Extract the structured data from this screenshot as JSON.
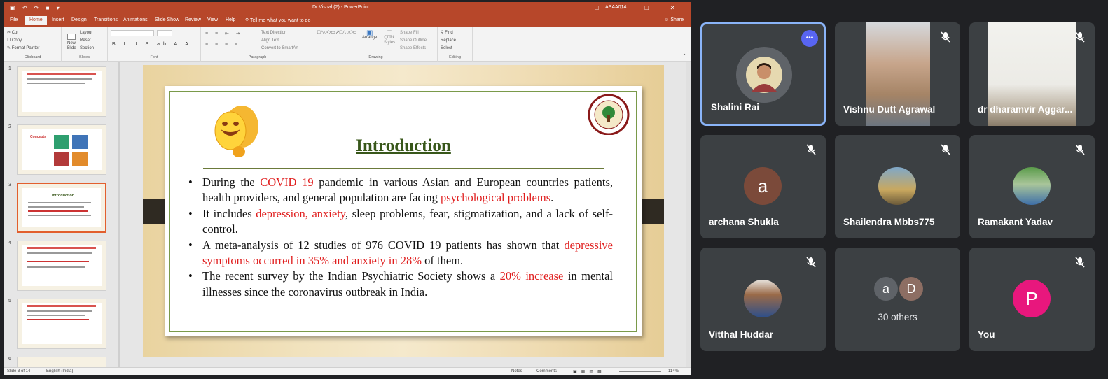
{
  "ppt": {
    "window_title": "Dr Vishal (2) - PowerPoint",
    "user": "ASAA014",
    "share_label": "Share",
    "tabs": [
      "File",
      "Home",
      "Insert",
      "Design",
      "Transitions",
      "Animations",
      "Slide Show",
      "Review",
      "View",
      "Help",
      "Tell me what you want to do"
    ],
    "active_tab": "Home",
    "ribbon": {
      "clipboard": {
        "label": "Clipboard",
        "cut": "Cut",
        "copy": "Copy",
        "format_painter": "Format Painter",
        "paste": "Paste"
      },
      "slides": {
        "label": "Slides",
        "new_slide": "New Slide",
        "layout": "Layout",
        "reset": "Reset",
        "section": "Section"
      },
      "font": {
        "label": "Font"
      },
      "paragraph": {
        "label": "Paragraph",
        "text_direction": "Text Direction",
        "align_text": "Align Text",
        "convert_smartart": "Convert to SmartArt"
      },
      "drawing": {
        "label": "Drawing",
        "arrange": "Arrange",
        "quick_styles": "Quick Styles",
        "shape_fill": "Shape Fill",
        "shape_outline": "Shape Outline",
        "shape_effects": "Shape Effects"
      },
      "editing": {
        "label": "Editing",
        "find": "Find",
        "replace": "Replace",
        "select": "Select"
      }
    },
    "thumbnails": [
      {
        "num": "1"
      },
      {
        "num": "2",
        "title": "Concepts"
      },
      {
        "num": "3",
        "title": "Introduction"
      },
      {
        "num": "4"
      },
      {
        "num": "5"
      },
      {
        "num": "6"
      }
    ],
    "selected_slide": 3,
    "status": {
      "slide": "Slide 3 of 14",
      "language": "English (India)",
      "notes": "Notes",
      "comments": "Comments",
      "zoom": "114%"
    },
    "slide": {
      "heading": "Introduction",
      "bullets": [
        {
          "a": "During the ",
          "b": "COVID 19",
          "c": " pandemic in various Asian and European countries patients, health providers, and general population are facing ",
          "d": "psychological problems",
          "e": "."
        },
        {
          "a": "It includes ",
          "b": "depression, anxiety",
          "c": ", sleep problems, fear, stigmatization, and a lack of self-control."
        },
        {
          "a": "A meta-analysis of 12 studies of 976 COVID 19 patients has shown that ",
          "b": "depressive symptoms occurred in 35% and anxiety in 28%",
          "c": " of them."
        },
        {
          "a": "The recent survey by the Indian Psychiatric Society shows a ",
          "b": "20% increase",
          "c": " in mental illnesses since the coronavirus outbreak in India."
        }
      ]
    }
  },
  "meet": {
    "tiles": [
      {
        "name": "Shalini Rai",
        "type": "photo",
        "more": "•••",
        "active": true
      },
      {
        "name": "Vishnu Dutt Agrawal",
        "type": "video"
      },
      {
        "name": "dr dharamvir Aggar...",
        "type": "video2"
      },
      {
        "name": "archana Shukla",
        "type": "letter",
        "letter": "a",
        "color": "#7b4a3a"
      },
      {
        "name": "Shailendra Mbbs775",
        "type": "photo2"
      },
      {
        "name": "Ramakant Yadav",
        "type": "photo3"
      },
      {
        "name": "Vitthal Huddar",
        "type": "photo4"
      },
      {
        "name": "30 others",
        "type": "others",
        "letters": [
          "a",
          "D"
        ]
      },
      {
        "name": "You",
        "type": "letter",
        "letter": "P",
        "color": "#e8177d"
      }
    ]
  }
}
